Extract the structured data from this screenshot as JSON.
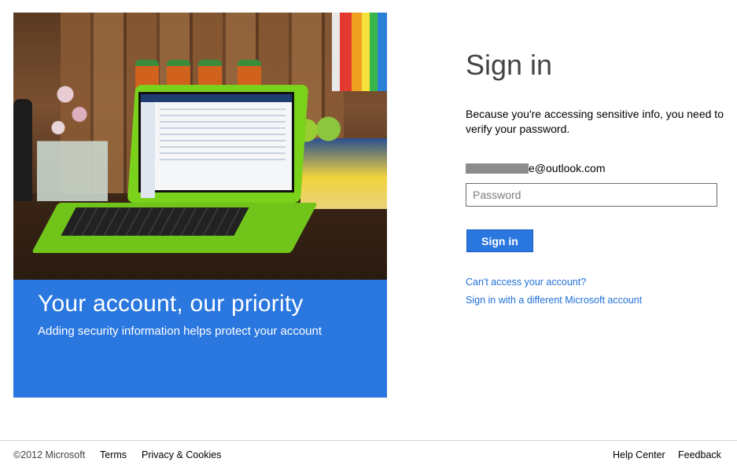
{
  "promo": {
    "title": "Your account, our priority",
    "subtitle": "Adding security information helps protect your account"
  },
  "signin": {
    "title": "Sign in",
    "description": "Because you're accessing sensitive info, you need to verify your password.",
    "email_visible": "e@outlook.com",
    "password_placeholder": "Password",
    "button_label": "Sign in",
    "link_cant_access": "Can't access your account?",
    "link_different_account": "Sign in with a different Microsoft account"
  },
  "footer": {
    "copyright": "©2012 Microsoft",
    "terms": "Terms",
    "privacy": "Privacy & Cookies",
    "help": "Help Center",
    "feedback": "Feedback"
  },
  "colors": {
    "accent_blue": "#2a77e0",
    "link_blue": "#1f6fd8",
    "laptop_green": "#7ad21a"
  }
}
